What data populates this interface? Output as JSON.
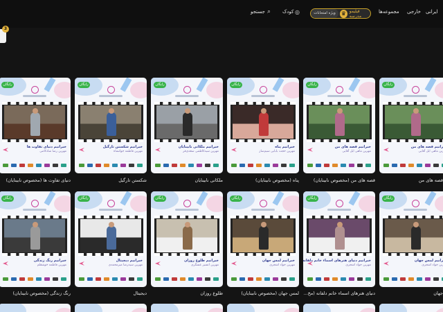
{
  "topbar": {
    "nav_iranian": "ایرانی",
    "nav_foreign": "خارجی",
    "nav_collections": "مجموعه‌ها",
    "premium_label": "فیلیمو مدرسه",
    "premium_sub": "ویژه امتحانات",
    "kids_label": "کودک",
    "search_label": "جستجو"
  },
  "row1": [
    {
      "title": "قصه های من",
      "cap1": "خبرانیم قصه های من",
      "cap2": "مهرین ماهی ایل آقایی"
    },
    {
      "title": "قصه های من (مخصوص نابینایان)",
      "cap1": "خبرانیم قصه های من",
      "cap2": "مهرین ماهی ایل آقایی"
    },
    {
      "title": "پناه (مخصوص نابینایان)",
      "cap1": "خبرانیم پناه",
      "cap2": "مهرین حجت بابایی سیم‌ساز"
    },
    {
      "title": "ملکانی نابینایان",
      "cap1": "خبرانیم ملکانی نابینایان",
      "cap2": "مهرین سیدکاظمی سعدی‌فر"
    },
    {
      "title": "شکستن تارگیل",
      "cap1": "خبرانیم شکستن تارگیل",
      "cap2": "مهرین فاطمه جوانشاه"
    },
    {
      "title": "دنیای تفاوت ها (مخصوص نابینایان)",
      "cap1": "خبرانیم دنیای تفاوت ها",
      "cap2": "مهرین رضا شادکامی"
    }
  ],
  "row2": [
    {
      "title": "جهان",
      "cap1": "خبرانیم لمس جهان",
      "cap2": "مهرین جواد اشجری"
    },
    {
      "title": "دنیای هنرهای اسماء خانم دلفانه (مخ...",
      "cap1": "خبرانیم دنیای هنرهای اسماء خانم دلفانه",
      "cap2": "مهرین جواد اشجری"
    },
    {
      "title": "لمس جهان (مخصوص نابینایان)",
      "cap1": "خبرانیم لمس جهان",
      "cap2": "مهرین جواد اشجری"
    },
    {
      "title": "طلوع روزان",
      "cap1": "خبرانیم طلوع روزان",
      "cap2": "مهرین انسیر عسگری"
    },
    {
      "title": "دیجیتال",
      "cap1": "خبرانیم دیجیتال",
      "cap2": "مهرین سیدرضا میرمحمدی"
    },
    {
      "title": "رنگ زندگی (مخصوص نابینایان)",
      "cap1": "خبرانیم رنگ زندگی",
      "cap2": "مهرین فاطمه خوشقلم"
    }
  ],
  "free_label": "رایگان",
  "side_badge": "3"
}
